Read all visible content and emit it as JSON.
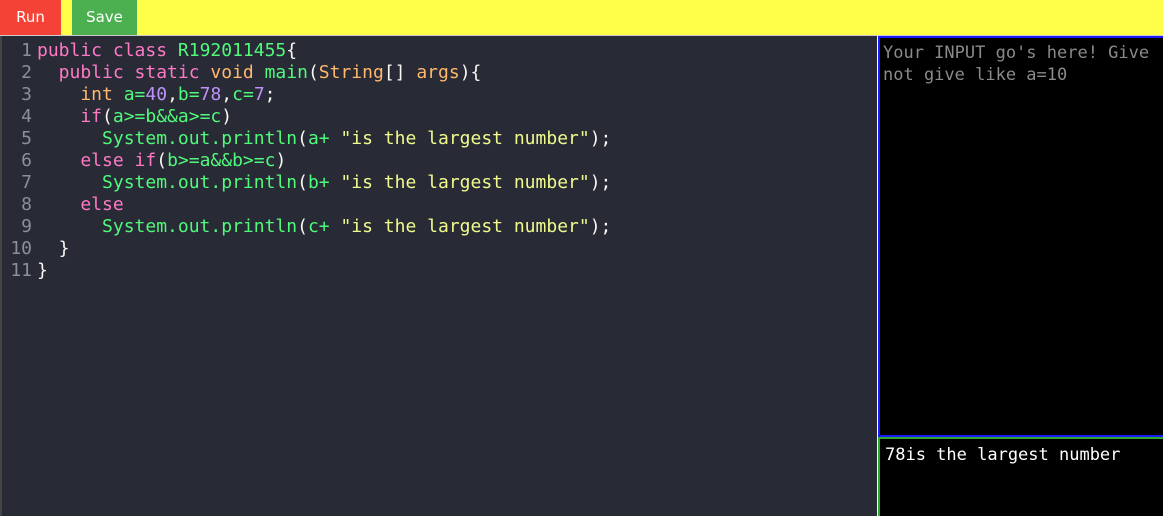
{
  "toolbar": {
    "run_label": "Run",
    "save_label": "Save"
  },
  "editor": {
    "lines": [
      [
        [
          "public class ",
          "kw"
        ],
        [
          "R192011455",
          "gr"
        ],
        [
          "{",
          "wh"
        ]
      ],
      [
        [
          "  public static ",
          "kw"
        ],
        [
          "void ",
          "or"
        ],
        [
          "main",
          "gr"
        ],
        [
          "(",
          "wh"
        ],
        [
          "String",
          "or"
        ],
        [
          "[] ",
          "wh"
        ],
        [
          "args",
          "or"
        ],
        [
          "){",
          "wh"
        ]
      ],
      [
        [
          "    int ",
          "or"
        ],
        [
          "a=",
          "gr"
        ],
        [
          "40",
          "nu"
        ],
        [
          ",",
          "wh"
        ],
        [
          "b=",
          "gr"
        ],
        [
          "78",
          "nu"
        ],
        [
          ",",
          "wh"
        ],
        [
          "c=",
          "gr"
        ],
        [
          "7",
          "nu"
        ],
        [
          ";",
          "wh"
        ]
      ],
      [
        [
          "    if",
          "kw"
        ],
        [
          "(",
          "wh"
        ],
        [
          "a>=b&&a>=c",
          "gr"
        ],
        [
          ")",
          "wh"
        ]
      ],
      [
        [
          "      System.out.println",
          "gr"
        ],
        [
          "(",
          "wh"
        ],
        [
          "a+ ",
          "gr"
        ],
        [
          "\"is the largest number\"",
          "st"
        ],
        [
          ");",
          "wh"
        ]
      ],
      [
        [
          "    else if",
          "kw"
        ],
        [
          "(",
          "wh"
        ],
        [
          "b>=a&&b>=c",
          "gr"
        ],
        [
          ")",
          "wh"
        ]
      ],
      [
        [
          "      System.out.println",
          "gr"
        ],
        [
          "(",
          "wh"
        ],
        [
          "b+ ",
          "gr"
        ],
        [
          "\"is the largest number\"",
          "st"
        ],
        [
          ");",
          "wh"
        ]
      ],
      [
        [
          "    else",
          "kw"
        ]
      ],
      [
        [
          "      System.out.println",
          "gr"
        ],
        [
          "(",
          "wh"
        ],
        [
          "c+ ",
          "gr"
        ],
        [
          "\"is the largest number\"",
          "st"
        ],
        [
          ");",
          "wh"
        ]
      ],
      [
        [
          "  }",
          "wh"
        ]
      ],
      [
        [
          "}",
          "wh"
        ]
      ]
    ]
  },
  "input": {
    "placeholder": "Your INPUT go's here! Give\nnot give like a=10"
  },
  "output": {
    "text": "78is the largest number"
  }
}
